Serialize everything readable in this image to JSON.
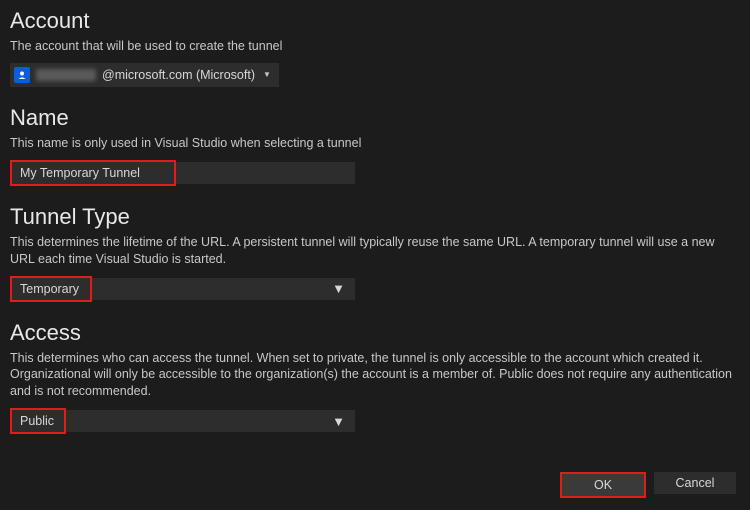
{
  "account": {
    "title": "Account",
    "desc": "The account that will be used to create the tunnel",
    "email_suffix": "@microsoft.com (Microsoft)"
  },
  "name": {
    "title": "Name",
    "desc": "This name is only used in Visual Studio when selecting a tunnel",
    "value": "My Temporary Tunnel"
  },
  "tunnel_type": {
    "title": "Tunnel Type",
    "desc": "This determines the lifetime of the URL. A persistent tunnel will typically reuse the same URL. A temporary tunnel will use a new URL each time Visual Studio is started.",
    "value": "Temporary"
  },
  "access": {
    "title": "Access",
    "desc": "This determines who can access the tunnel. When set to private, the tunnel is only accessible to the account which created it. Organizational will only be accessible to the organization(s) the account is a member of. Public does not require any authentication and is not recommended.",
    "value": "Public"
  },
  "buttons": {
    "ok": "OK",
    "cancel": "Cancel"
  }
}
